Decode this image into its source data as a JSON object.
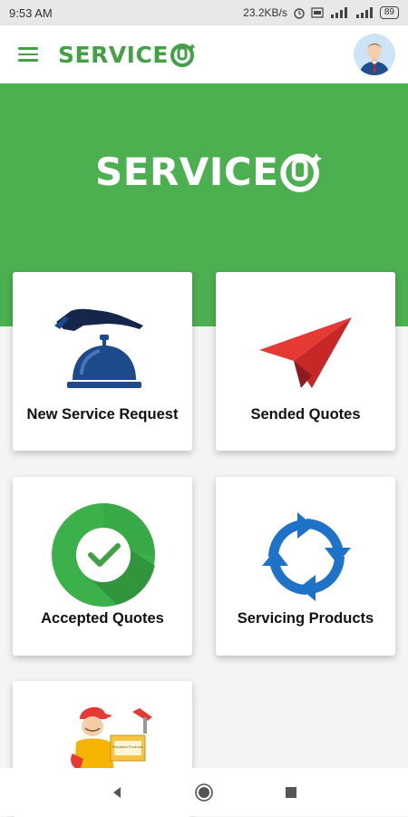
{
  "status_bar": {
    "time": "9:53 AM",
    "network_speed": "23.2KB/s",
    "battery_level": "89",
    "icons": [
      "alarm-icon",
      "vo-lte-icon",
      "signal-icon",
      "signal-icon",
      "battery-icon"
    ]
  },
  "app_bar": {
    "logo_text": "SERVICE",
    "icons": [
      "menu-icon",
      "avatar-icon"
    ]
  },
  "hero": {
    "logo_text": "SERVICE"
  },
  "cards": [
    {
      "label": "New Service Request",
      "icon": "service-bell-icon"
    },
    {
      "label": "Sended Quotes",
      "icon": "paper-plane-icon"
    },
    {
      "label": "Accepted Quotes",
      "icon": "check-circle-icon"
    },
    {
      "label": "Servicing Products",
      "icon": "refresh-icon"
    },
    {
      "label": "",
      "icon": "delivery-person-icon",
      "box_text": "Repaired Products"
    }
  ],
  "nav": {
    "icons": [
      "back-icon",
      "home-icon",
      "recents-icon"
    ]
  },
  "colors": {
    "brand_green": "#4caf50",
    "logo_green": "#43a047",
    "plane_red": "#e53935",
    "bell_blue": "#1e4a8c",
    "refresh_blue": "#1e73c8"
  }
}
